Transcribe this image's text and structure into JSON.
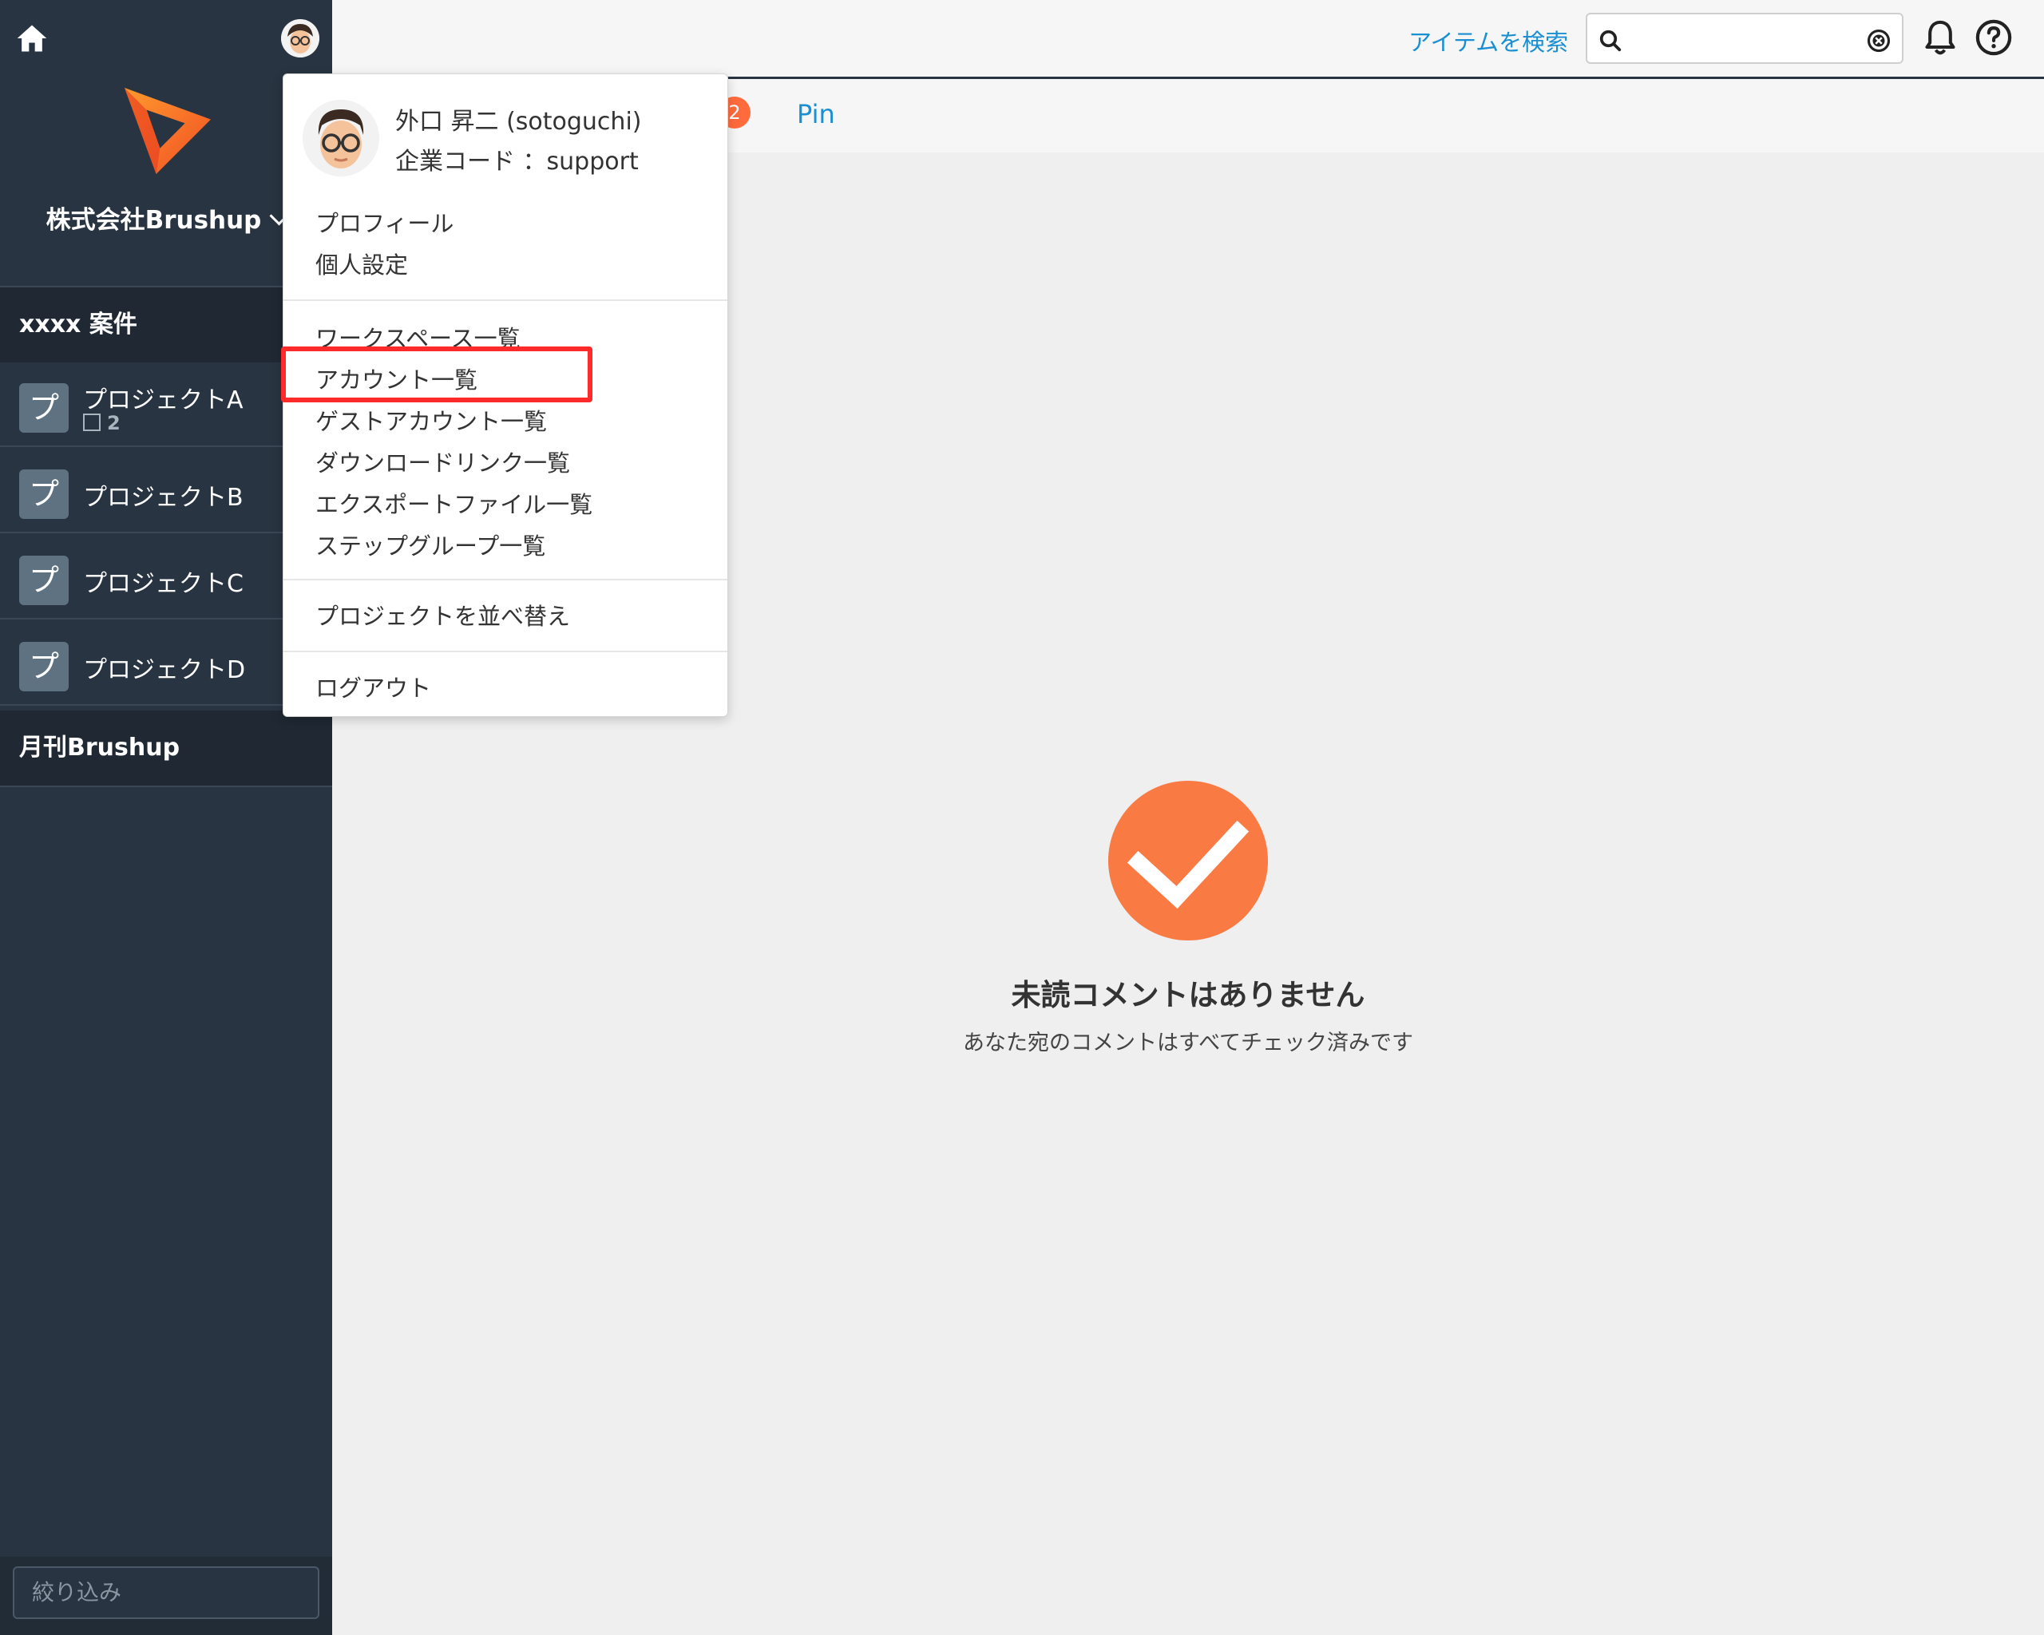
{
  "sidebar": {
    "company_name": "株式会社Brushup",
    "section_title": "xxxx 案件",
    "projects": [
      {
        "badge": "プ",
        "name": "プロジェクトA",
        "count": "2"
      },
      {
        "badge": "プ",
        "name": "プロジェクトB"
      },
      {
        "badge": "プ",
        "name": "プロジェクトC"
      },
      {
        "badge": "プ",
        "name": "プロジェクトD"
      }
    ],
    "second_section_title": "月刊Brushup",
    "filter_placeholder": "絞り込み"
  },
  "topbar": {
    "search_link": "アイテムを検索",
    "search_value": "",
    "icons": [
      "home-icon",
      "search-icon",
      "clear-icon",
      "bell-icon",
      "help-icon"
    ]
  },
  "tabs": {
    "badge_count": "2",
    "pin_label": "Pin"
  },
  "empty_state": {
    "title": "未読コメントはありません",
    "subtitle": "あなた宛のコメントはすべてチェック済みです"
  },
  "dropdown": {
    "user_name": "外口 昇二 (sotoguchi)",
    "company_code": "企業コード ：support",
    "group1": [
      "プロフィール",
      "個人設定"
    ],
    "group2": [
      "ワークスペース一覧",
      "アカウント一覧",
      "ゲストアカウント一覧",
      "ダウンロードリンク一覧",
      "エクスポートファイル一覧",
      "ステップグループ一覧"
    ],
    "sort_projects": "プロジェクトを並べ替え",
    "logout": "ログアウト"
  },
  "colors": {
    "sidebar": "#283441",
    "accent_orange": "#fa7a44",
    "link_blue": "#1a8fd1",
    "highlight_red": "#ff2a2a"
  }
}
